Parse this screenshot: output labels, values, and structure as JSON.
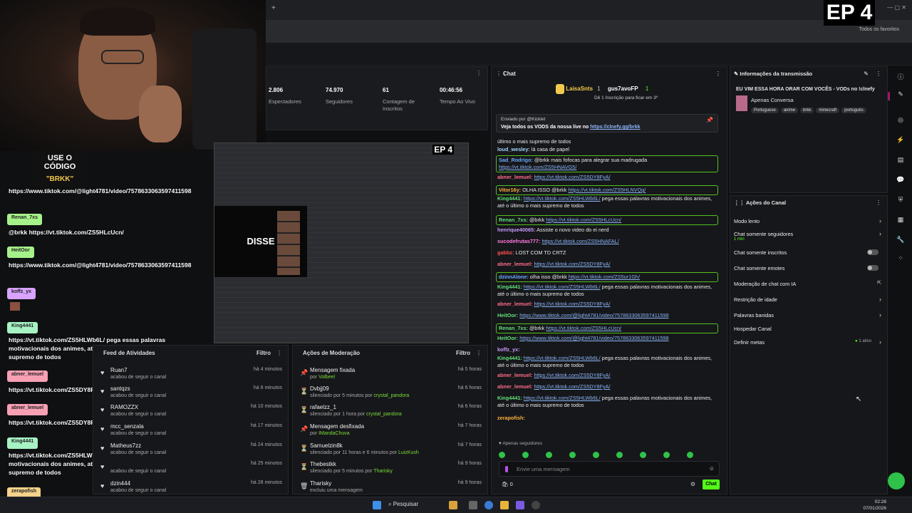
{
  "browser": {
    "favorites": "Todos os favoritos"
  },
  "ep_badge": "EP 4",
  "promo": {
    "line1": "USE O CÓDIGO",
    "line2": "\"BRKK\""
  },
  "stats": [
    {
      "value": "2.806",
      "label": "Espectadores"
    },
    {
      "value": "74.970",
      "label": "Seguidores"
    },
    {
      "value": "61",
      "label": "Contagem de Inscritos"
    },
    {
      "value": "00:46:56",
      "label": "Tempo Ao Vivo"
    }
  ],
  "nested": {
    "badge": "EP 4",
    "word": "DISSE"
  },
  "overlay_chat": [
    {
      "user": "",
      "msg": "https://www.tiktok.com/@light4781/video/7578633063597411598",
      "color": "#cfe8ff"
    },
    {
      "user": "Renan_7xs",
      "msg": "@brkk https://vt.tiktok.com/ZS5HLcUcn/",
      "color": "#a6f28a"
    },
    {
      "user": "HeitOor",
      "msg": "https://www.tiktok.com/@light4781/video/7578633063597411598",
      "color": "#a6f28a"
    },
    {
      "user": "koffz_yx",
      "msg": "",
      "color": "#d8a2ff"
    },
    {
      "user": "King4441",
      "msg": "https://vt.tiktok.com/ZS5HLWb6L/ pega essas palavras motivacionais dos animes, até a último o mais supremo de todos",
      "color": "#a6f2c4"
    },
    {
      "user": "abner_lemuel",
      "msg": "https://vt.tiktok.com/ZS5DY8FyA/",
      "color": "#f7a0b4"
    },
    {
      "user": "abner_lemuel",
      "msg": "https://vt.tiktok.com/ZS5DY8FyA/",
      "color": "#f7a0b4"
    },
    {
      "user": "King4441",
      "msg": "https://vt.tiktok.com/ZS5HLWb6L/ pega essas palavras motivacionais dos animes, até a último o mais supremo de todos",
      "color": "#a6f2c4"
    },
    {
      "user": "zerapofish",
      "msg": "",
      "color": "#f7d28a"
    }
  ],
  "feed": {
    "title": "Feed de Atividades",
    "filter": "Filtro",
    "rows": [
      {
        "name": "Ruan7",
        "sub": "acabou de seguir o canal",
        "time": "há 4 minutos"
      },
      {
        "name": "santqzs",
        "sub": "acabou de seguir o canal",
        "time": "há 6 minutos"
      },
      {
        "name": "RAMOZZX",
        "sub": "acabou de seguir o canal",
        "time": "há 10 minutos"
      },
      {
        "name": "mcc_senzala",
        "sub": "acabou de seguir o canal",
        "time": "há 17 minutos"
      },
      {
        "name": "Matheus7zz",
        "sub": "acabou de seguir o canal",
        "time": "há 24 minutos"
      },
      {
        "name": "",
        "sub": "acabou de seguir o canal",
        "time": "há 25 minutos"
      },
      {
        "name": "dzin444",
        "sub": "acabou de seguir o canal",
        "time": "há 28 minutos"
      }
    ]
  },
  "moderation": {
    "title": "Ações de Moderação",
    "filter": "Filtro",
    "rows": [
      {
        "icon": "📌",
        "name": "Mensagem fixada",
        "sub": "por ",
        "by": "Volbeel",
        "time": "há 5 horas"
      },
      {
        "icon": "⏳",
        "name": "Dvbjj09",
        "sub": "silenciado por 5 minutos por ",
        "by": "crystal_pandora",
        "time": "há 6 horas"
      },
      {
        "icon": "⏳",
        "name": "rafaelzz_1",
        "sub": "silenciado por 1 hora por ",
        "by": "crystal_pandora",
        "time": "há 6 horas"
      },
      {
        "icon": "📌",
        "name": "Mensagem desfixada",
        "sub": "por ",
        "by": "IMandaChuva",
        "time": "há 7 horas"
      },
      {
        "icon": "⏳",
        "name": "Samuelzin8k",
        "sub": "silenciado por 11 horas e 6 minutos por ",
        "by": "LuizKush",
        "time": "há 7 horas"
      },
      {
        "icon": "⏳",
        "name": "Thebestkk",
        "sub": "silenciado por 5 minutos por ",
        "by": "Tharisky",
        "time": "há 9 horas"
      },
      {
        "icon": "🗑",
        "name": "Tharisky",
        "sub": "excluiu uma mensagem",
        "by": "",
        "time": "há 9 horas"
      }
    ]
  },
  "chat": {
    "title": "Chat",
    "leader1": "LaisaSnts",
    "leader1_count": "1",
    "leader2": "gus7avoFP",
    "leader2_count": "1",
    "leader_note": "Dê 1 Inscrição para ficar em 3º",
    "pin_sender": "Enviado por",
    "pin_user": "@Kicklet",
    "pin_text": "Veja todos os VODS da nossa live no ",
    "pin_link": "https://clnefy.gg/brkk",
    "messages": [
      {
        "u": "",
        "uc": "#ddd",
        "t": "último o mais supremo de todos",
        "link": "",
        "hl": false
      },
      {
        "u": "loud_wesley:",
        "uc": "#9fd6ff",
        "t": "lá casa de papel",
        "link": "",
        "hl": false
      },
      {
        "u": "Sad_Rodrigo:",
        "uc": "#6aa9ff",
        "t": "@brkk mais fofocas para alegrar sua madrugada ",
        "link": "https://vt.tiktok.com/ZS5HNAVG5/",
        "hl": true
      },
      {
        "u": "abner_lemuel:",
        "uc": "#ff6b8a",
        "t": "",
        "link": "https://vt.tiktok.com/ZS5DY8FyA/",
        "hl": false
      },
      {
        "u": "Vitor16y:",
        "uc": "#ffb13b",
        "t": "OLHA ISSO @brkk ",
        "link": "https://vt.tiktok.com/ZS5HLNVQg/",
        "hl": true
      },
      {
        "u": "King4441:",
        "uc": "#5ee07a",
        "t": "",
        "link": "https://vt.tiktok.com/ZS5HLWb6L/",
        "tail": " pega essas palavras motivacionais dos animes, até o último o mais supremo de todos",
        "hl": false
      },
      {
        "u": "Renan_7xs:",
        "uc": "#5ee07a",
        "t": "@brkk ",
        "link": "https://vt.tiktok.com/ZS5HLcUcn/",
        "hl": true
      },
      {
        "u": "henrique40065:",
        "uc": "#c89bff",
        "t": "Assiste o novo video do ei nerd",
        "link": "",
        "hl": false
      },
      {
        "u": "sucodefrutas777:",
        "uc": "#ff7be0",
        "t": "",
        "link": "https://vt.tiktok.com/ZS5HNAFAL/",
        "hl": false
      },
      {
        "u": "gabbz:",
        "uc": "#ff5050",
        "t": "LOST COM TD CRTZ",
        "link": "",
        "hl": false
      },
      {
        "u": "abner_lemuel:",
        "uc": "#ff6b8a",
        "t": "",
        "link": "https://vt.tiktok.com/ZS5DY8FyA/",
        "hl": false
      },
      {
        "u": "dzinnAlone:",
        "uc": "#6aa9ff",
        "t": "olha isso @brkk ",
        "link": "https://vt.tiktok.com/ZS5ur1Gh/",
        "hl": true
      },
      {
        "u": "King4441:",
        "uc": "#5ee07a",
        "t": "",
        "link": "https://vt.tiktok.com/ZS5HLWb6L/",
        "tail": " pega essas palavras motivacionais dos animes, até o último o mais supremo de todos",
        "hl": false
      },
      {
        "u": "abner_lemuel:",
        "uc": "#ff6b8a",
        "t": "",
        "link": "https://vt.tiktok.com/ZS5DY8FyA/",
        "hl": false
      },
      {
        "u": "HeitOor:",
        "uc": "#5ee07a",
        "t": "",
        "link": "https://www.tiktok.com/@light4781/video/7578633063597411598",
        "hl": false
      },
      {
        "u": "Renan_7xs:",
        "uc": "#5ee07a",
        "t": "@brkk ",
        "link": "https://vt.tiktok.com/ZS5HLcUcn/",
        "hl": true
      },
      {
        "u": "HeitOor:",
        "uc": "#5ee07a",
        "t": "",
        "link": "https://www.tiktok.com/@light4781/video/7578633063597411598",
        "hl": false
      },
      {
        "u": "koffz_yx:",
        "uc": "#c89bff",
        "t": "",
        "link": "",
        "hl": false
      },
      {
        "u": "King4441:",
        "uc": "#5ee07a",
        "t": "",
        "link": "https://vt.tiktok.com/ZS5HLWb6L/",
        "tail": " pega essas palavras motivacionais dos animes, até o último o mais supremo de todos",
        "hl": false
      },
      {
        "u": "abner_lemuel:",
        "uc": "#ff6b8a",
        "t": "",
        "link": "https://vt.tiktok.com/ZS5DY8FyA/",
        "hl": false
      },
      {
        "u": "abner_lemuel:",
        "uc": "#ff6b8a",
        "t": "",
        "link": "https://vt.tiktok.com/ZS5DY8FyA/",
        "hl": false
      },
      {
        "u": "King4441:",
        "uc": "#5ee07a",
        "t": "",
        "link": "https://vt.tiktok.com/ZS5HLWb6L/",
        "tail": " pega essas palavras motivacionais dos animes, até o último o mais supremo de todos",
        "hl": false
      },
      {
        "u": "zerapofish:",
        "uc": "#ffb13b",
        "t": "",
        "link": "",
        "hl": false
      }
    ],
    "followers_only": "Apenas seguidores",
    "placeholder": "Envie uma mensagem",
    "count": "0",
    "send": "Chat"
  },
  "info": {
    "title": "Informações da transmissão",
    "stream_title": "EU VIM ESSA HORA ORAR COM VOCÊS - VODs no !clnefy",
    "category": "Apenas Conversa",
    "tags": [
      "Portuguese",
      "anime",
      "brkk",
      "minecraft",
      "português"
    ]
  },
  "actions": {
    "title": "Ações do Canal",
    "items": [
      {
        "label": "Modo lento",
        "kind": "arrow",
        "sub": ""
      },
      {
        "label": "Chat somente seguidores",
        "kind": "arrow",
        "sub": "1 min"
      },
      {
        "label": "Chat somente inscritos",
        "kind": "toggle",
        "sub": ""
      },
      {
        "label": "Chat somente emotes",
        "kind": "toggle",
        "sub": ""
      },
      {
        "label": "Moderação de chat com IA",
        "kind": "ext",
        "sub": ""
      },
      {
        "label": "Restrição de idade",
        "kind": "arrow",
        "sub": ""
      },
      {
        "label": "Palavras banidas",
        "kind": "arrow",
        "sub": ""
      },
      {
        "label": "Hospedar Canal",
        "kind": "none",
        "sub": ""
      },
      {
        "label": "Definir metas",
        "kind": "arrow",
        "sub": "1 ativo"
      }
    ]
  },
  "taskbar": {
    "search": "Pesquisar",
    "time": "02:28",
    "date": "07/01/2026"
  }
}
